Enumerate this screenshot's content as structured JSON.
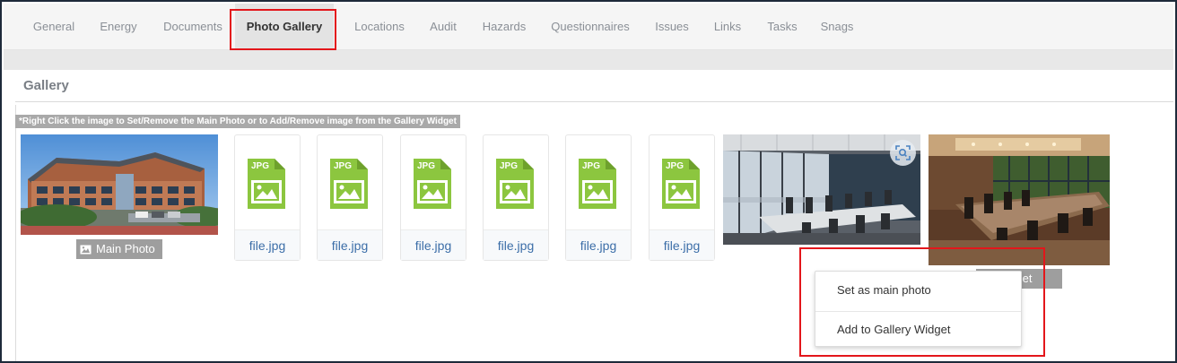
{
  "tabs": [
    {
      "label": "General"
    },
    {
      "label": "Energy"
    },
    {
      "label": "Documents"
    },
    {
      "label": "Photo Gallery",
      "active": true
    },
    {
      "label": "Locations"
    },
    {
      "label": "Audit"
    },
    {
      "label": "Hazards"
    },
    {
      "label": "Questionnaires"
    },
    {
      "label": "Issues"
    },
    {
      "label": "Links"
    },
    {
      "label": "Tasks"
    },
    {
      "label": "Snags"
    }
  ],
  "section": {
    "title": "Gallery",
    "hint": "*Right Click the image to Set/Remove the Main Photo or to Add/Remove image from the Gallery Widget"
  },
  "main_photo": {
    "badge": "Main Photo",
    "icon": "image-icon"
  },
  "files": [
    {
      "name": "file.jpg",
      "icon": "jpg-file-icon"
    },
    {
      "name": "file.jpg",
      "icon": "jpg-file-icon"
    },
    {
      "name": "file.jpg",
      "icon": "jpg-file-icon"
    },
    {
      "name": "file.jpg",
      "icon": "jpg-file-icon"
    },
    {
      "name": "file.jpg",
      "icon": "jpg-file-icon"
    },
    {
      "name": "file.jpg",
      "icon": "jpg-file-icon"
    }
  ],
  "jpg_icon_label": "JPG",
  "widget_photo": {
    "badge": "Widget",
    "icon": "image-icon"
  },
  "zoom_icon": "focus-zoom-icon",
  "context_menu": {
    "items": [
      {
        "label": "Set as main photo"
      },
      {
        "label": "Add to Gallery Widget"
      }
    ]
  },
  "colors": {
    "highlight": "#e3161b",
    "jpg_green": "#8cc63f",
    "link_blue": "#3c6ea8",
    "badge_grey": "#9e9e9e"
  }
}
